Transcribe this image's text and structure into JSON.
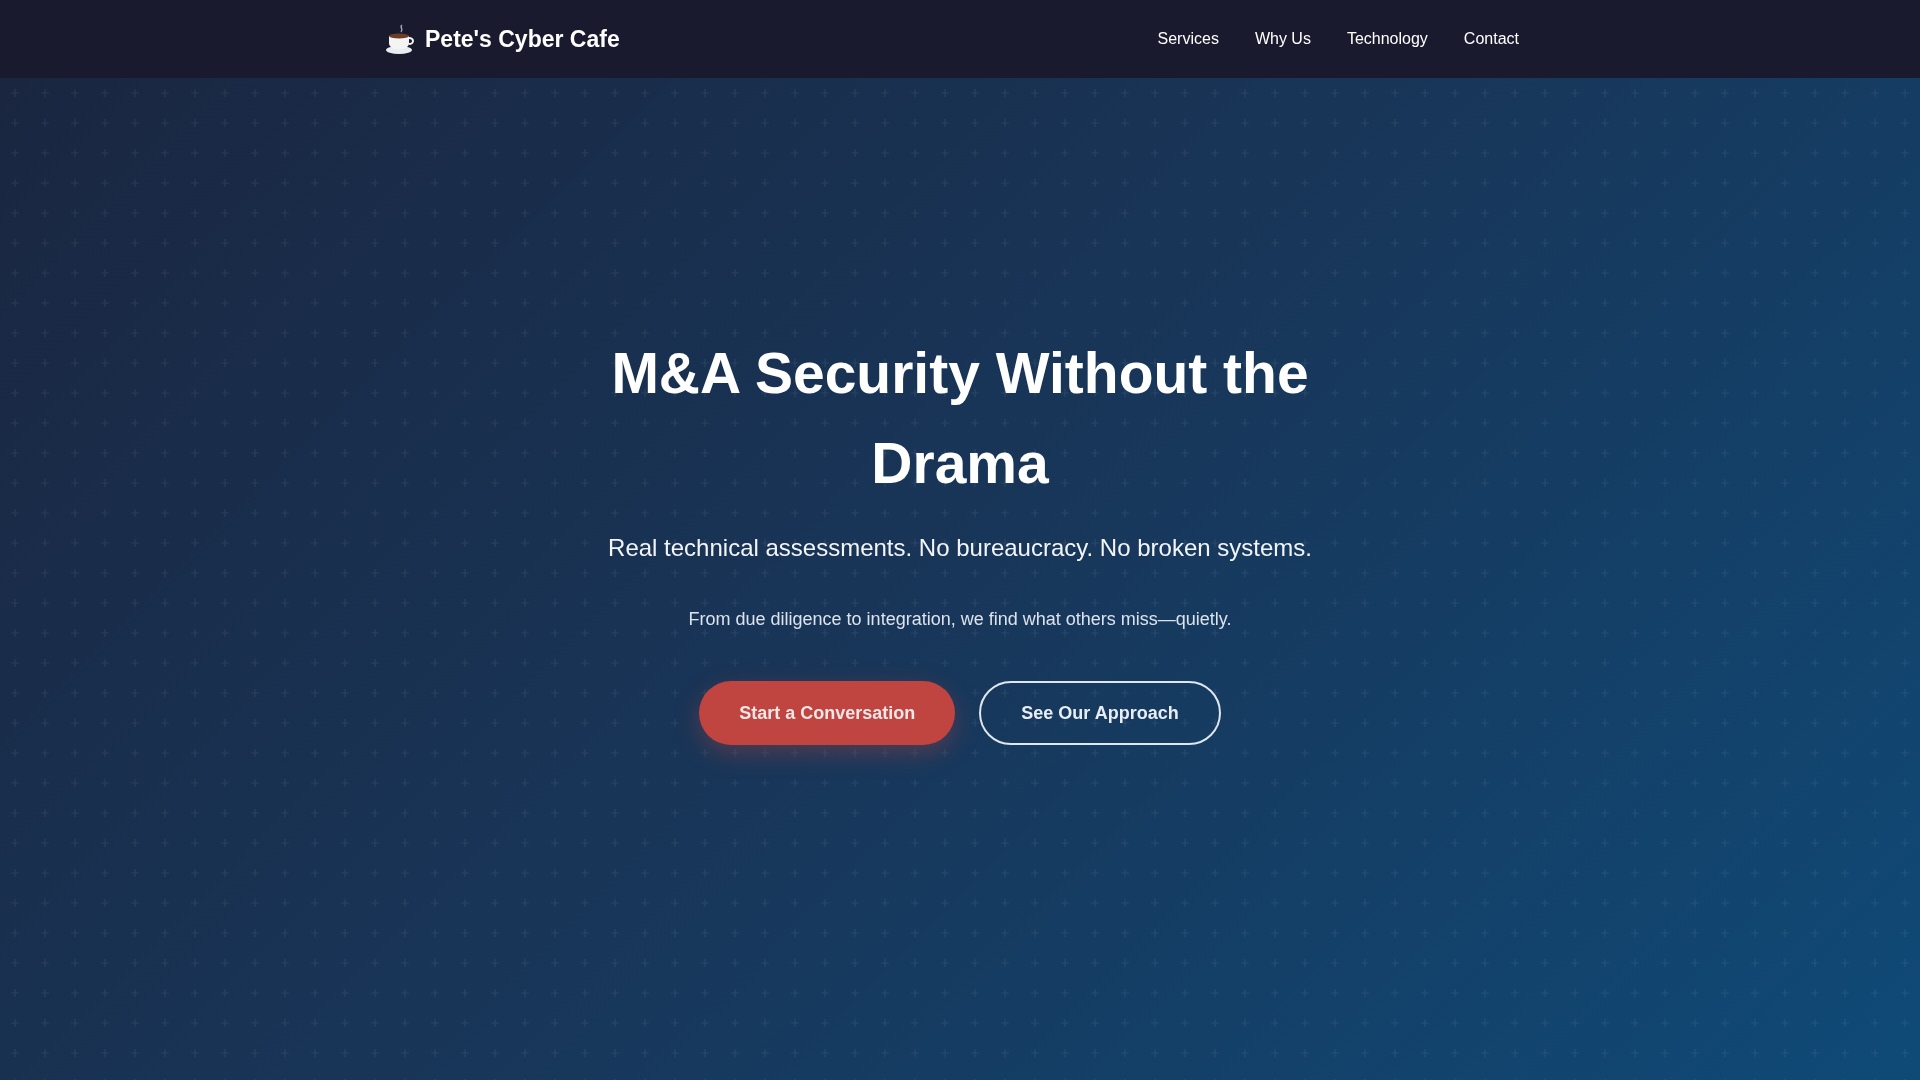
{
  "navbar": {
    "brand": "Pete's Cyber Cafe",
    "links": [
      {
        "label": "Services"
      },
      {
        "label": "Why Us"
      },
      {
        "label": "Technology"
      },
      {
        "label": "Contact"
      }
    ]
  },
  "hero": {
    "title": "M&A Security Without the Drama",
    "subtitle": "Real technical assessments. No bureaucracy. No broken systems.",
    "text": "From due diligence to integration, we find what others miss—quietly.",
    "buttons": [
      {
        "label": "Start a Conversation",
        "kind": "primary"
      },
      {
        "label": "See Our Approach",
        "kind": "outline"
      }
    ]
  }
}
